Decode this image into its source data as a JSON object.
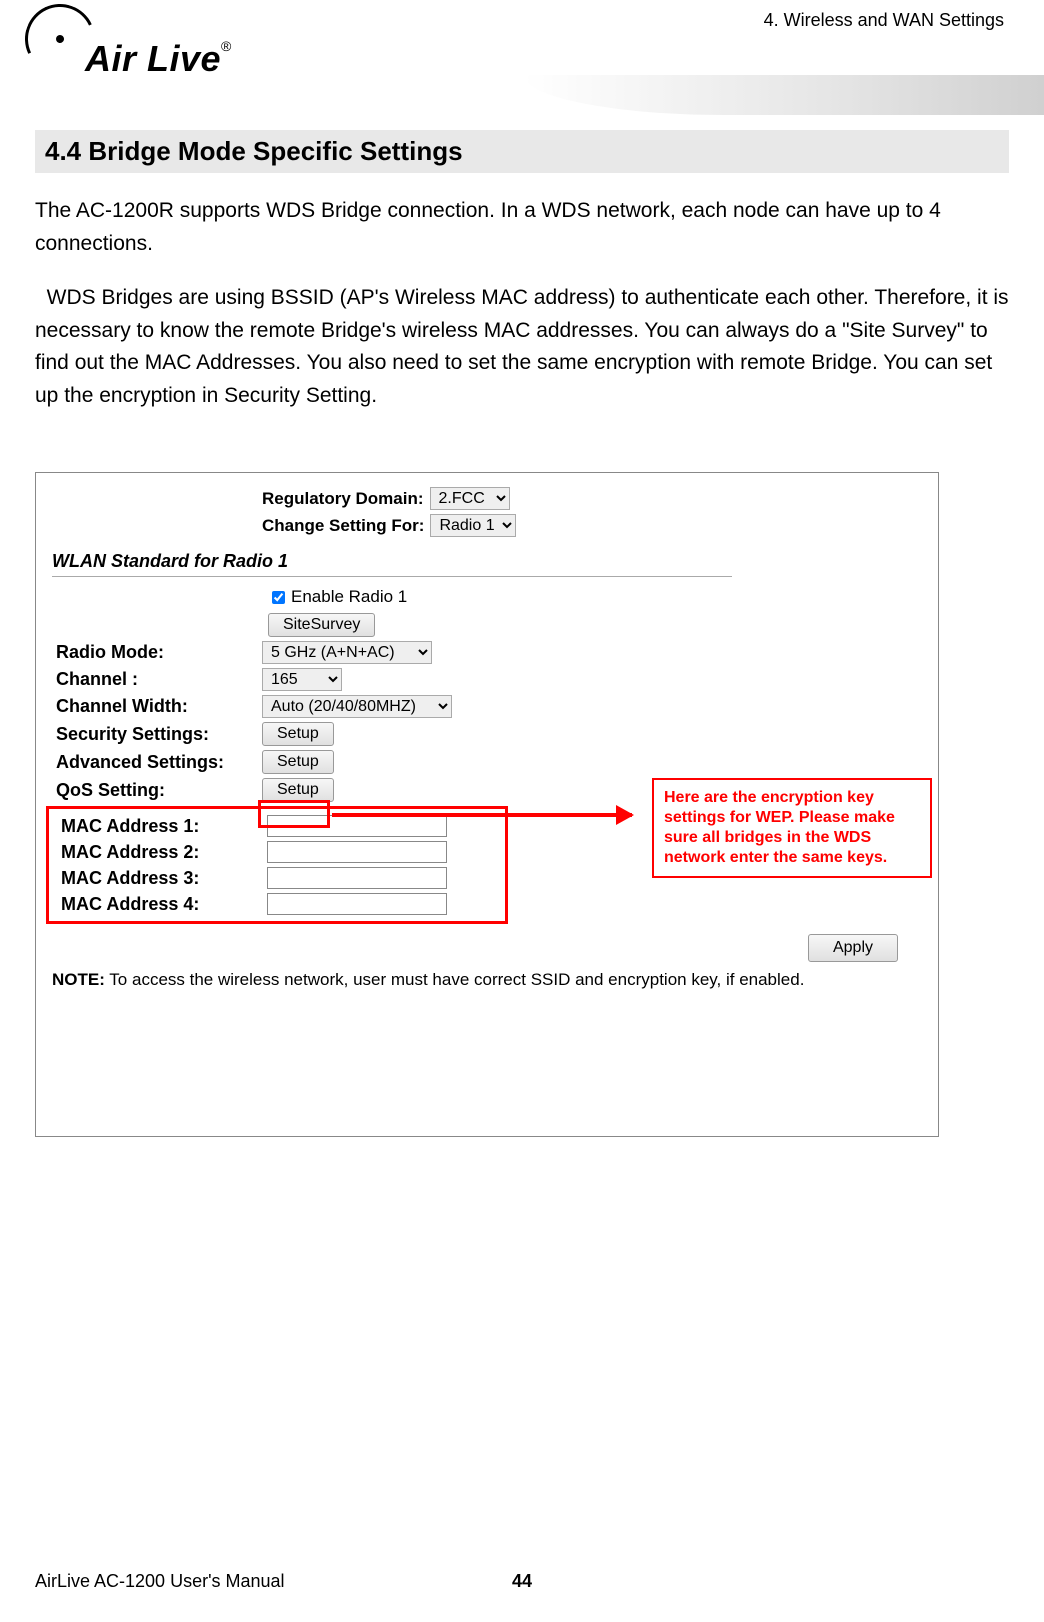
{
  "header": {
    "running_title": "4. Wireless and WAN Settings",
    "logo_text": "Air Live",
    "logo_reg": "®"
  },
  "section": {
    "heading": "4.4 Bridge Mode Specific Settings",
    "para1": "The AC-1200R supports WDS Bridge connection. In a WDS network, each node can have up to 4 connections.",
    "para2": "  WDS Bridges are using BSSID (AP's Wireless MAC address) to authenticate each other. Therefore, it is necessary to know the remote Bridge's wireless MAC addresses. You can always do a \"Site Survey\" to find out the MAC Addresses. You also need to set the same encryption with remote Bridge. You can set up the encryption in Security Setting."
  },
  "figure": {
    "reg_domain_label": "Regulatory Domain:",
    "reg_domain_value": "2.FCC",
    "change_for_label": "Change Setting For:",
    "change_for_value": "Radio 1",
    "wlan_heading": "WLAN Standard for Radio 1",
    "enable_radio_label": "Enable Radio 1",
    "enable_radio_checked": true,
    "site_survey_btn": "SiteSurvey",
    "radio_mode_label": "Radio Mode:",
    "radio_mode_value": "5 GHz (A+N+AC)",
    "channel_label": "Channel :",
    "channel_value": "165",
    "channel_width_label": "Channel Width:",
    "channel_width_value": "Auto (20/40/80MHZ)",
    "security_label": "Security Settings:",
    "security_btn": "Setup",
    "advanced_label": "Advanced Settings:",
    "advanced_btn": "Setup",
    "qos_label": "QoS Setting:",
    "qos_btn": "Setup",
    "mac1_label": "MAC Address 1:",
    "mac2_label": "MAC Address 2:",
    "mac3_label": "MAC Address 3:",
    "mac4_label": "MAC Address 4:",
    "apply_btn": "Apply",
    "note_bold": "NOTE:",
    "note_text": " To access the wireless network, user must have correct SSID and encryption key, if enabled."
  },
  "callout": {
    "text": "Here are the encryption key settings for WEP. Please make sure all bridges in the WDS network enter the same keys."
  },
  "footer": {
    "left": "AirLive AC-1200 User's Manual",
    "page": "44"
  }
}
